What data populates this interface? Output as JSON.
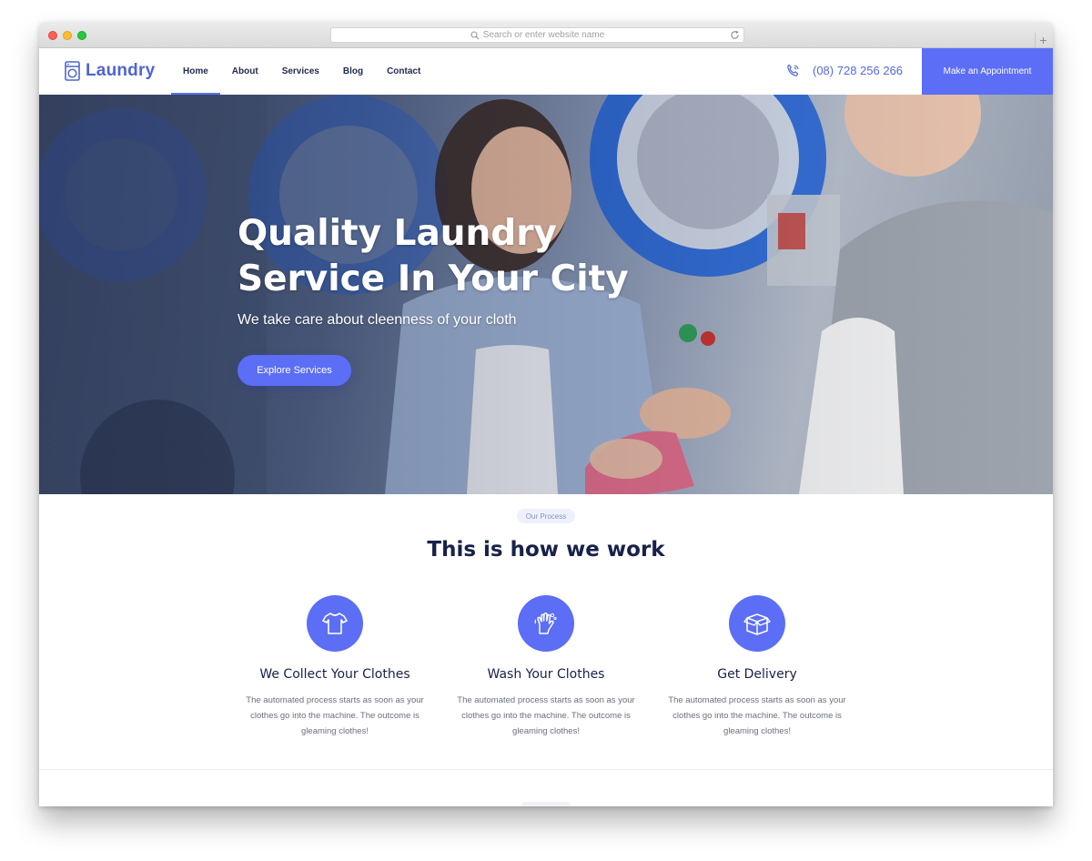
{
  "browser": {
    "url_placeholder": "Search or enter website name",
    "new_tab_symbol": "+"
  },
  "header": {
    "logo_text": "Laundry",
    "nav": [
      {
        "label": "Home",
        "active": true
      },
      {
        "label": "About",
        "active": false
      },
      {
        "label": "Services",
        "active": false
      },
      {
        "label": "Blog",
        "active": false
      },
      {
        "label": "Contact",
        "active": false
      }
    ],
    "phone": "(08) 728 256 266",
    "appointment_label": "Make an Appointment"
  },
  "hero": {
    "title_line1": "Quality Laundry",
    "title_line2": "Service In Your City",
    "subtitle": "We take care about cleenness of your cloth",
    "button_label": "Explore Services"
  },
  "process": {
    "pill": "Our Process",
    "title": "This is how we work",
    "steps": [
      {
        "icon": "tshirt-icon",
        "title": "We Collect Your Clothes",
        "text": "The automated process starts as soon as your clothes go into the machine. The outcome is gleaming clothes!"
      },
      {
        "icon": "washing-hands-icon",
        "title": "Wash Your Clothes",
        "text": "The automated process starts as soon as your clothes go into the machine. The outcome is gleaming clothes!"
      },
      {
        "icon": "box-icon",
        "title": "Get Delivery",
        "text": "The automated process starts as soon as your clothes go into the machine. The outcome is gleaming clothes!"
      }
    ]
  },
  "colors": {
    "accent": "#5b6ef5",
    "brand": "#4f64d3",
    "heading": "#17214a",
    "body_text": "#6b7080"
  }
}
